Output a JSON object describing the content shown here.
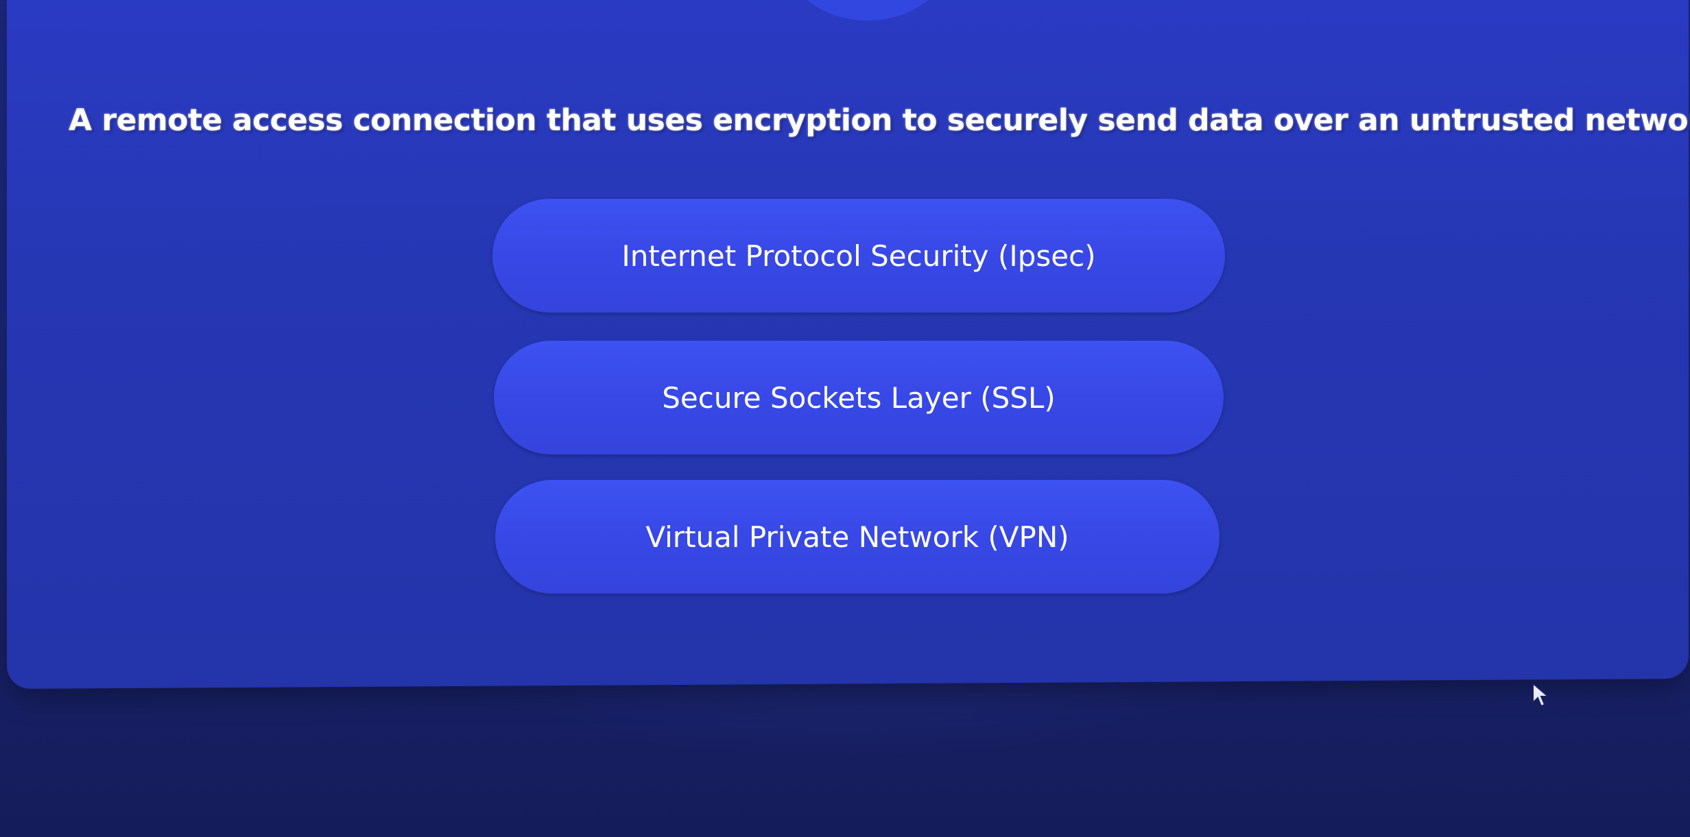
{
  "quiz": {
    "question": "A remote access connection that uses encryption to securely send data over an untrusted network.",
    "options": [
      {
        "label": "Internet Protocol Security (Ipsec)"
      },
      {
        "label": "Secure Sockets Layer (SSL)"
      },
      {
        "label": "Virtual Private Network (VPN)"
      }
    ]
  },
  "colors": {
    "background": "#1e2a86",
    "card": "#2a3bc4",
    "option": "#3d52f2",
    "text": "#ffffff"
  },
  "icons": {
    "cursor": "mouse-pointer-icon"
  }
}
